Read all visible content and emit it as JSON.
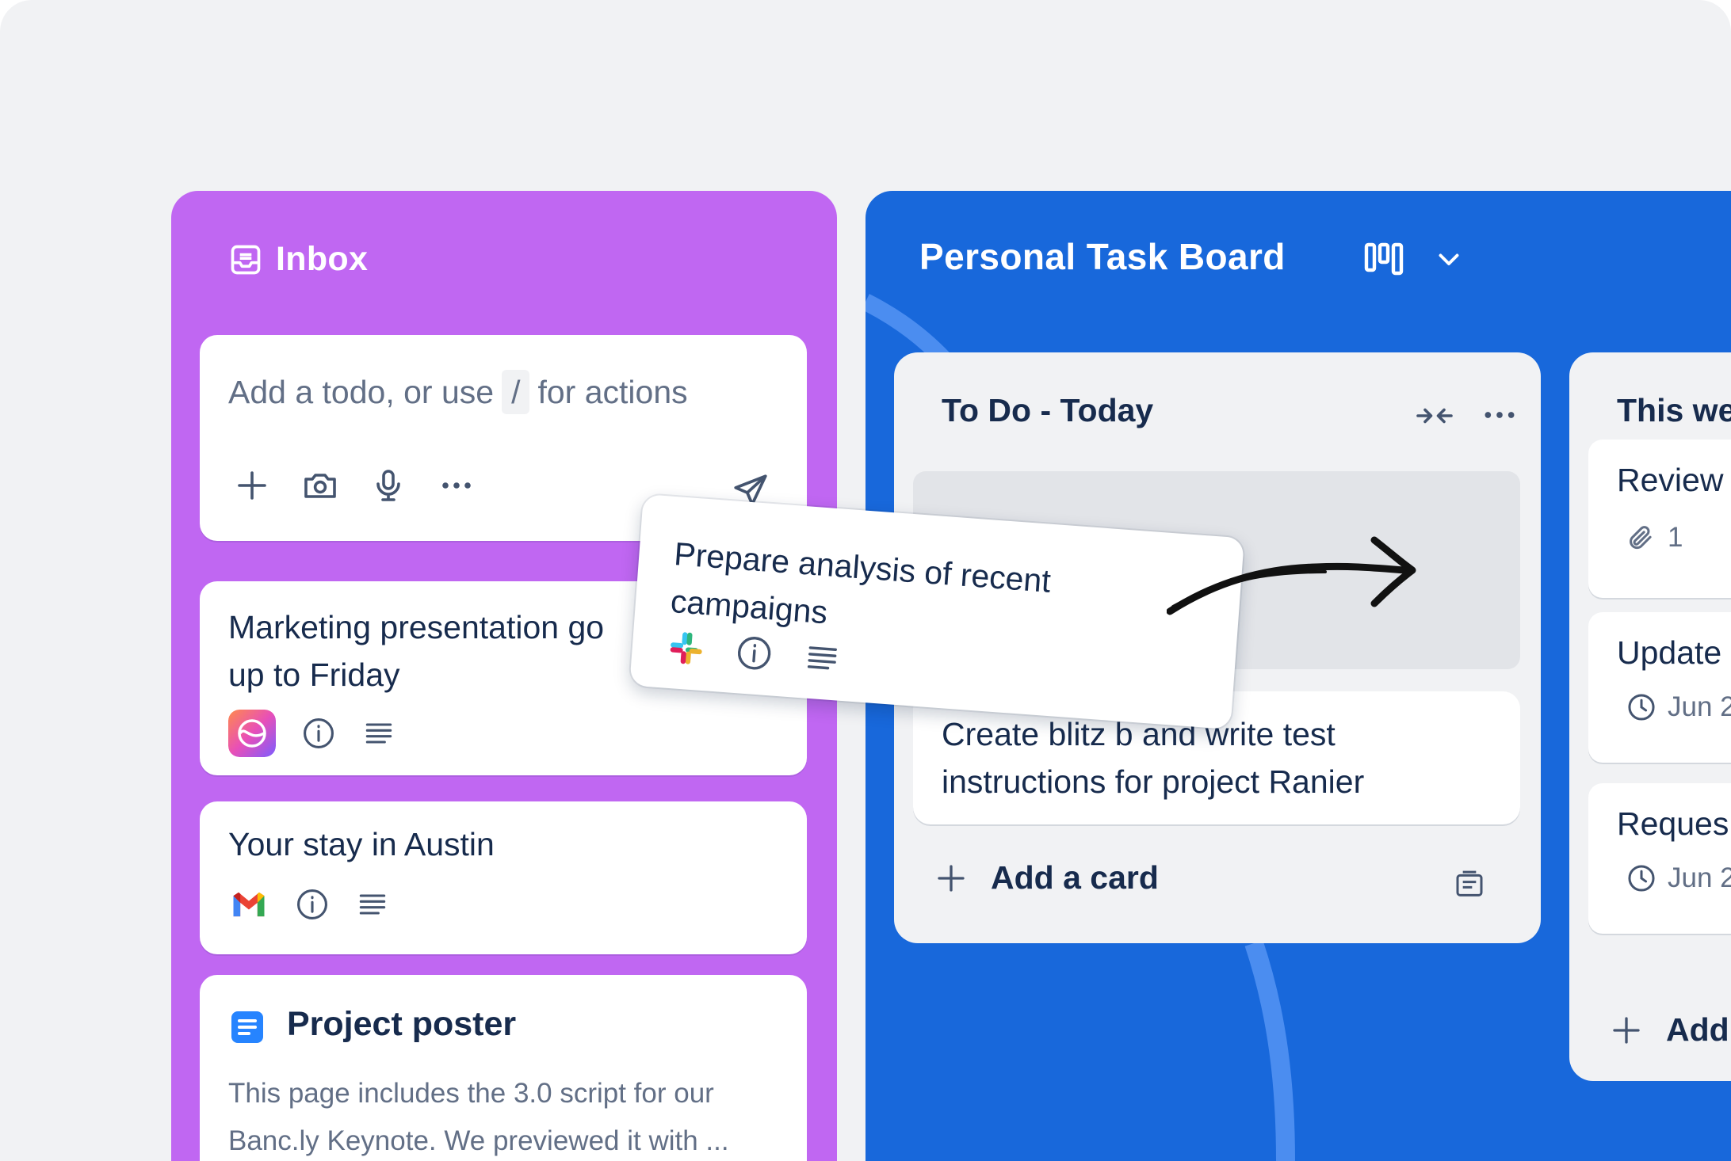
{
  "inbox": {
    "title": "Inbox",
    "composer": {
      "placeholder_before": "Add a todo, or use",
      "shortcut_key": "/",
      "placeholder_after": "for actions"
    },
    "cards": [
      {
        "title": "Marketing presentation go",
        "title_line2": "up to Friday"
      },
      {
        "title": "Your stay in Austin"
      },
      {
        "title": "Project poster",
        "body": "This page includes the 3.0 script for our Banc.ly Keynote. We previewed it with ..."
      }
    ]
  },
  "board": {
    "title": "Personal Task Board",
    "lists": [
      {
        "title": "To Do - Today",
        "cards": [
          {
            "title": "Create blitz b        and write test instructions for project Ranier"
          }
        ],
        "add_label": "Add a card"
      },
      {
        "title": "This we",
        "cards": [
          {
            "title": "Review",
            "meta": "1",
            "meta_icon": "attachment-icon"
          },
          {
            "title": "Update",
            "meta": "Jun 2",
            "meta_icon": "clock-icon"
          },
          {
            "title": "Reques",
            "meta": "Jun 2",
            "meta_icon": "clock-icon"
          }
        ],
        "add_label": "Add"
      }
    ]
  },
  "dragged_card": {
    "title": "Prepare analysis of recent campaigns",
    "source_app": "slack-icon"
  },
  "colors": {
    "inbox_bg": "#c067f2",
    "board_bg": "#1868db",
    "list_bg": "#f1f2f4",
    "text_primary": "#172b4d",
    "text_subtle": "#626f86"
  }
}
